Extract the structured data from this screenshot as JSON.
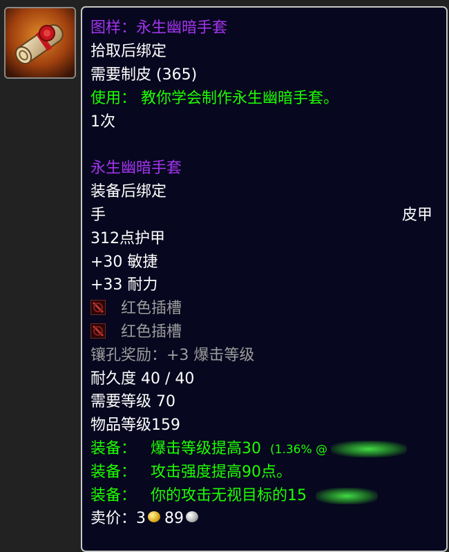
{
  "icon": {
    "name": "pattern-scroll-icon"
  },
  "tooltip": {
    "title": "图样：永生幽暗手套",
    "bind_pickup": "拾取后绑定",
    "requires_skill": "需要制皮 (365)",
    "use_text": "使用： 教你学会制作永生幽暗手套。",
    "charges": "1次",
    "item_name": "永生幽暗手套",
    "bind_equip": "装备后绑定",
    "slot": "手",
    "armor_type": "皮甲",
    "armor": "312点护甲",
    "agility": "+30 敏捷",
    "stamina": "+33 耐力",
    "sockets": [
      {
        "label": "红色插槽",
        "icon": "red-socket-icon"
      },
      {
        "label": "红色插槽",
        "icon": "red-socket-icon"
      }
    ],
    "socket_bonus": "镶孔奖励：+3 爆击等级",
    "durability": "耐久度 40 / 40",
    "required_level": "需要等级 70",
    "item_level": "物品等级159",
    "equip_effects": [
      {
        "prefix": "装备：",
        "text": "爆击等级提高30",
        "extra": "(1.36% @"
      },
      {
        "prefix": "装备：",
        "text": "攻击强度提高90点。",
        "extra": ""
      },
      {
        "prefix": "装备：",
        "text": "你的攻击无视目标的15",
        "extra": ""
      }
    ],
    "sell_label": "卖价：",
    "sell_gold": "3",
    "sell_silver": "89"
  },
  "colors": {
    "epic_purple": "#a335ee",
    "uncommon_green": "#1eff00",
    "grey": "#9d9d9d",
    "background": "#07071f"
  }
}
